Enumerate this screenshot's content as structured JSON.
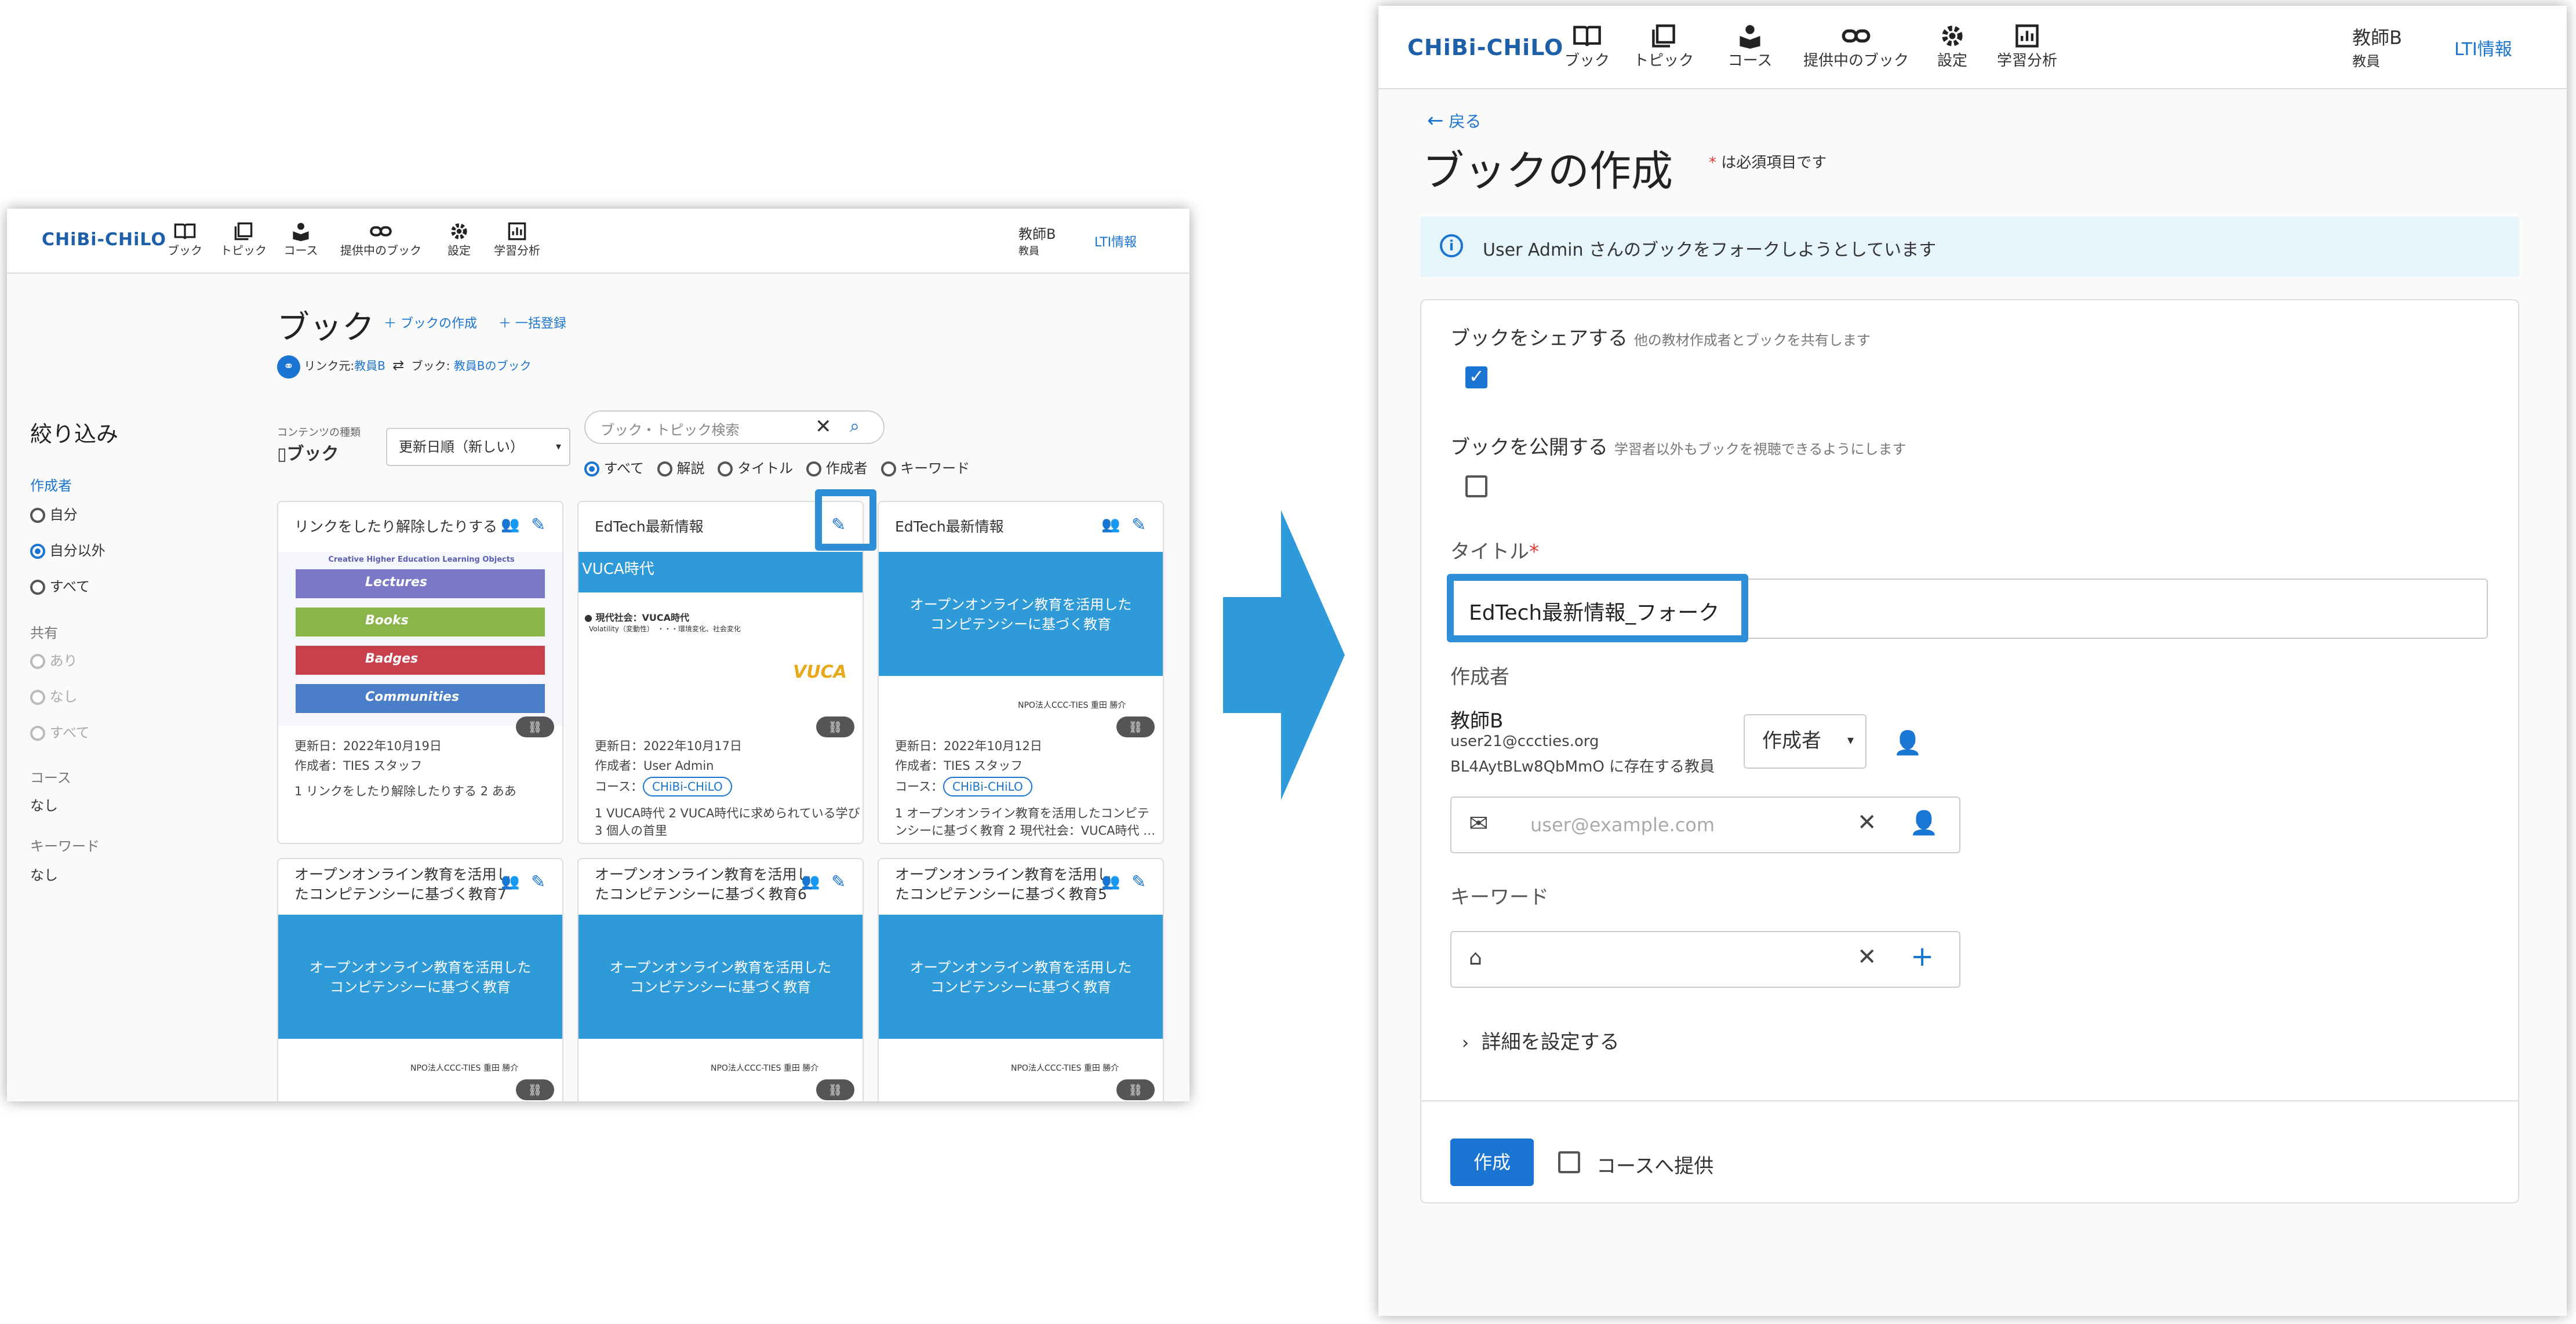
{
  "left": {
    "nav": {
      "logo": "CHiBi-CHiLO",
      "items": [
        "ブック",
        "トピック",
        "コース",
        "提供中のブック",
        "設定",
        "学習分析"
      ],
      "user_name": "教師B",
      "user_role": "教員",
      "lti": "LTI情報"
    },
    "page_title": "ブック",
    "create_link": "ブックの作成",
    "bulk_link": "一括登録",
    "link_info": {
      "prefix": "リンク元:",
      "source": "教員B",
      "book_prefix": "ブック:",
      "book": "教員Bのブック"
    },
    "content_type_label": "コンテンツの種類",
    "content_type": "ブック",
    "sort": "更新日順（新しい）",
    "search_placeholder": "ブック・トピック検索",
    "search_filters": [
      "すべて",
      "解説",
      "タイトル",
      "作成者",
      "キーワード"
    ],
    "filter": {
      "title": "絞り込み",
      "author_label": "作成者",
      "author_options": [
        "自分",
        "自分以外",
        "すべて"
      ],
      "share_label": "共有",
      "share_options": [
        "あり",
        "なし",
        "すべて"
      ],
      "course_label": "コース",
      "course_value": "なし",
      "keyword_label": "キーワード",
      "keyword_value": "なし"
    },
    "cards": [
      {
        "title": "リンクをしたり解除したりする",
        "updated": "更新日：2022年10月19日",
        "author": "作成者：TIES スタッフ",
        "course": "",
        "desc": "1 リンクをしたり解除したりする 2 ああ"
      },
      {
        "title": "EdTech最新情報",
        "updated": "更新日：2022年10月17日",
        "author": "作成者：User Admin",
        "course": "CHiBi-CHiLO",
        "desc1": "1 VUCA時代 2 VUCA時代に求められている学び",
        "desc2": "3 個人の首里"
      },
      {
        "title": "EdTech最新情報",
        "updated": "更新日：2022年10月12日",
        "author": "作成者：TIES スタッフ",
        "course": "CHiBi-CHiLO",
        "desc1": "1 オープンオンライン教育を活用したコンピテ",
        "desc2": "ンシーに基づく教育 2 現代社会：VUCA時代 …"
      },
      {
        "title1": "オープンオンライン教育を活用し",
        "title2": "たコンピテンシーに基づく教育7"
      },
      {
        "title1": "オープンオンライン教育を活用し",
        "title2": "たコンピテンシーに基づく教育6"
      },
      {
        "title1": "オープンオンライン教育を活用し",
        "title2": "たコンピテンシーに基づく教育5"
      }
    ],
    "course_prefix": "コース：",
    "thumb1": {
      "heading": "Creative Higher Education Learning Objects",
      "rows": [
        "Lectures",
        "Books",
        "Badges",
        "Communities"
      ]
    },
    "thumb2": {
      "banner": "VUCA時代",
      "bullet": "● 現代社会：VUCA時代",
      "sub": "Volatility（変動性）　・・・環境変化、社会変化",
      "logo": "VUCA"
    },
    "thumb_blue": {
      "line1": "オープンオンライン教育を活用した",
      "line2": "コンピテンシーに基づく教育",
      "footer": "NPO法人CCC-TIES",
      "footer_name": "重田 勝介"
    }
  },
  "right": {
    "nav": {
      "logo": "CHiBi-CHiLO",
      "items": [
        "ブック",
        "トピック",
        "コース",
        "提供中のブック",
        "設定",
        "学習分析"
      ],
      "user_name": "教師B",
      "user_role": "教員",
      "lti": "LTI情報"
    },
    "back": "戻る",
    "title": "ブックの作成",
    "required_note": "は必須項目です",
    "info": "User Admin さんのブックをフォークしようとしています",
    "share_label": "ブックをシェアする",
    "share_hint": "他の教材作成者とブックを共有します",
    "share_checked": true,
    "publish_label": "ブックを公開する",
    "publish_hint": "学習者以外もブックを視聴できるようにします",
    "publish_checked": false,
    "title_label": "タイトル",
    "title_value": "EdTech最新情報_フォーク",
    "author_label": "作成者",
    "author_name": "教師B",
    "author_email": "user21@cccties.org",
    "author_org": "BL4AytBLw8QbMmO に存在する教員",
    "author_role": "作成者",
    "email_placeholder": "user@example.com",
    "keyword_label": "キーワード",
    "details": "詳細を設定する",
    "create_button": "作成",
    "course_offer": "コースへ提供"
  },
  "colors": {
    "accent": "#1a75d2",
    "highlight": "#2e8fd6",
    "arrow": "#2f9ad9",
    "required": "#e53935",
    "info_bg": "#e6f4fb"
  }
}
